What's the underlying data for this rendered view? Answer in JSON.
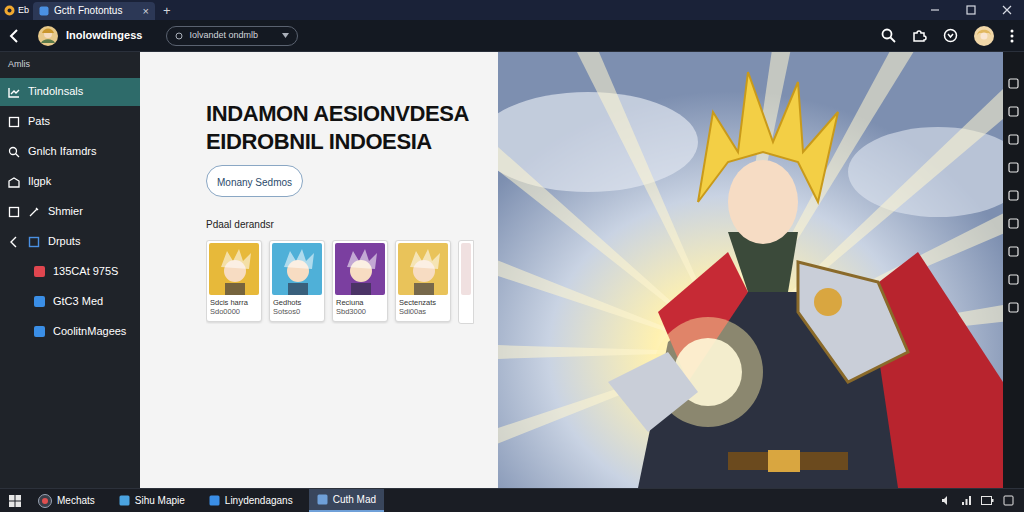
{
  "window": {
    "app_label": "Eb",
    "title": "Gcth Fnotontus",
    "tab_close": "×",
    "new_tab": "+"
  },
  "toolbar": {
    "profile_name": "Inolowdingess",
    "dropdown": "Iolvandet ondmlb"
  },
  "sidebar": {
    "header": "Amlis",
    "items": [
      {
        "label": "Tindolnsals",
        "selected": true,
        "kind": "main"
      },
      {
        "label": "Pats",
        "selected": false,
        "kind": "main"
      },
      {
        "label": "Gnlch Ifamdrs",
        "selected": false,
        "kind": "main"
      },
      {
        "label": "Ilgpk",
        "selected": false,
        "kind": "main"
      },
      {
        "label": "Shmier",
        "selected": false,
        "kind": "main"
      },
      {
        "label": "Drputs",
        "selected": false,
        "kind": "main"
      },
      {
        "label": "135CAt 975S",
        "selected": false,
        "kind": "sub",
        "color": "#e0464f"
      },
      {
        "label": "GtC3 Med",
        "selected": false,
        "kind": "sub",
        "color": "#3a8ee6"
      },
      {
        "label": "CoolitnMagees",
        "selected": false,
        "kind": "sub",
        "color": "#3a8ee6"
      }
    ]
  },
  "main": {
    "heading": [
      "INDAMON AESIONVDESA",
      "EIDROBNIL INDOESIA"
    ],
    "button": "Monany Sedmos",
    "section_label": "Pdaal derandsr",
    "cards": [
      {
        "title": "Sdcis harra",
        "subtitle": "Sdo0000",
        "color": "#e7b93a"
      },
      {
        "title": "Gedhots",
        "subtitle": "Sotsos0",
        "color": "#4fb0d8"
      },
      {
        "title": "Reciuna",
        "subtitle": "Sbd3000",
        "color": "#7b3fa0"
      },
      {
        "title": "Sectenzats",
        "subtitle": "Sdi00as",
        "color": "#e9c35a"
      }
    ]
  },
  "taskbar": {
    "items": [
      {
        "label": "Mechats",
        "selected": false
      },
      {
        "label": "Sihu Mapie",
        "selected": false
      },
      {
        "label": "Linydendagans",
        "selected": false
      },
      {
        "label": "Cuth Mad",
        "selected": true
      }
    ]
  }
}
